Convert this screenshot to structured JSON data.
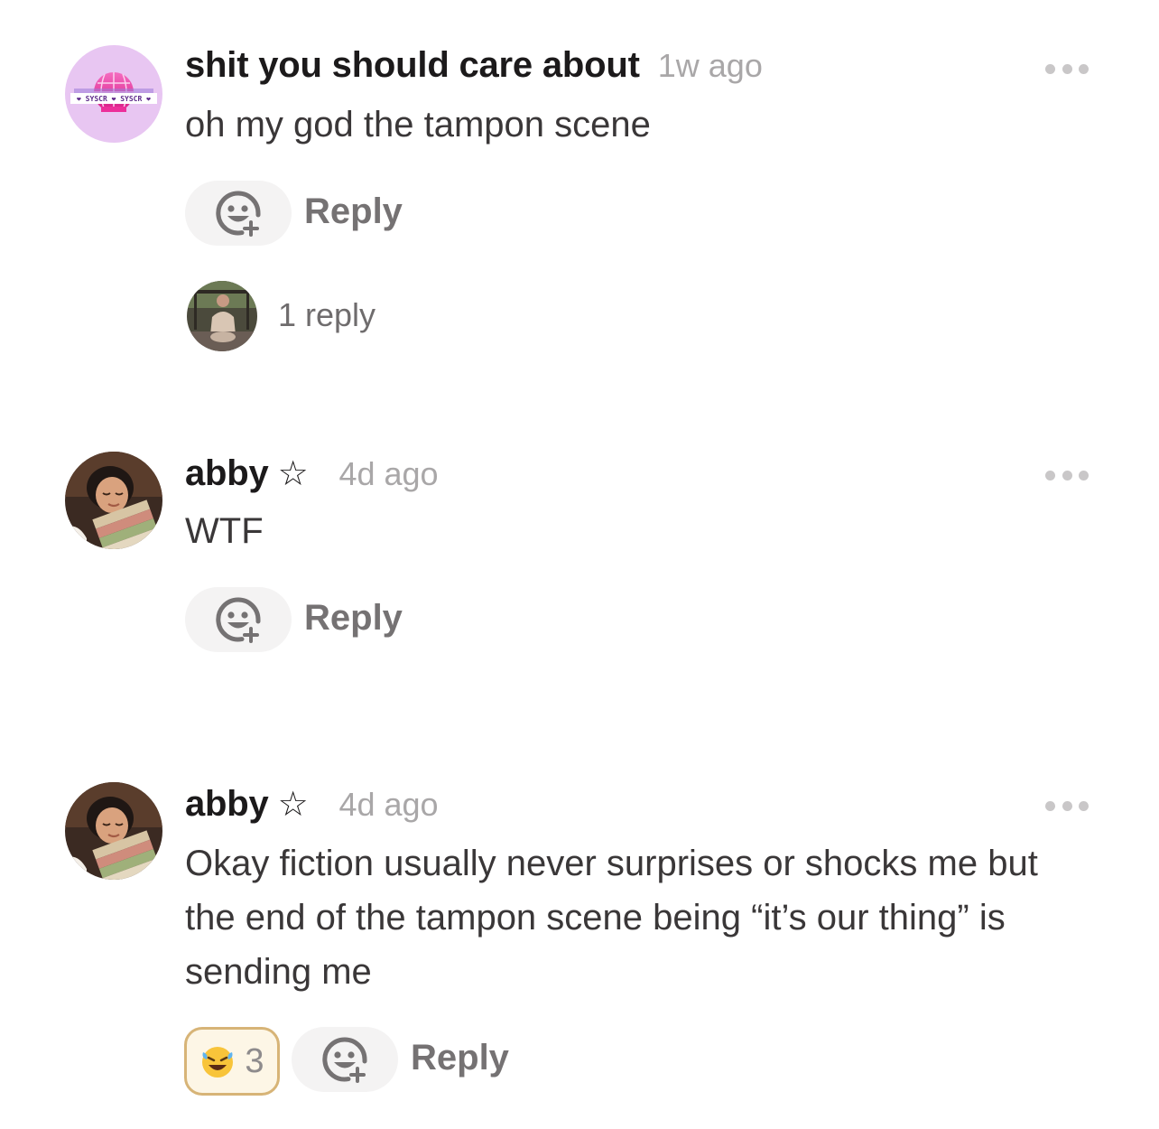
{
  "comments": [
    {
      "author": "shit you should care about",
      "star": "",
      "time": "1w ago",
      "body": "oh my god the tampon scene",
      "reply_label": "Reply",
      "replies_count": "1 reply"
    },
    {
      "author": "abby",
      "star": "☆",
      "time": "4d ago",
      "body": "WTF",
      "reply_label": "Reply"
    },
    {
      "author": "abby",
      "star": "☆",
      "time": "4d ago",
      "body": "Okay fiction usually never surprises or shocks me but the end of the tampon scene being “it’s our thing” is sending me",
      "reply_label": "Reply",
      "reaction": {
        "emoji": "laughing-tears-emoji",
        "count": "3"
      }
    }
  ],
  "avatars": {
    "first_logo_text": "❤ SYSCR ❤ SYSCR ❤"
  },
  "icons": {
    "more": "ellipsis-icon",
    "add_reaction": "add-reaction-icon"
  },
  "colors": {
    "author": "#1c1a1b",
    "timestamp": "#a9a7a8",
    "body": "#3a3738",
    "reply": "#757273",
    "pill_bg": "#f4f3f3",
    "reaction_border": "#d7b477",
    "reaction_bg": "#fdf6e6",
    "logo_bg": "#e8c6f2",
    "logo_pink": "#ec2f9a"
  }
}
